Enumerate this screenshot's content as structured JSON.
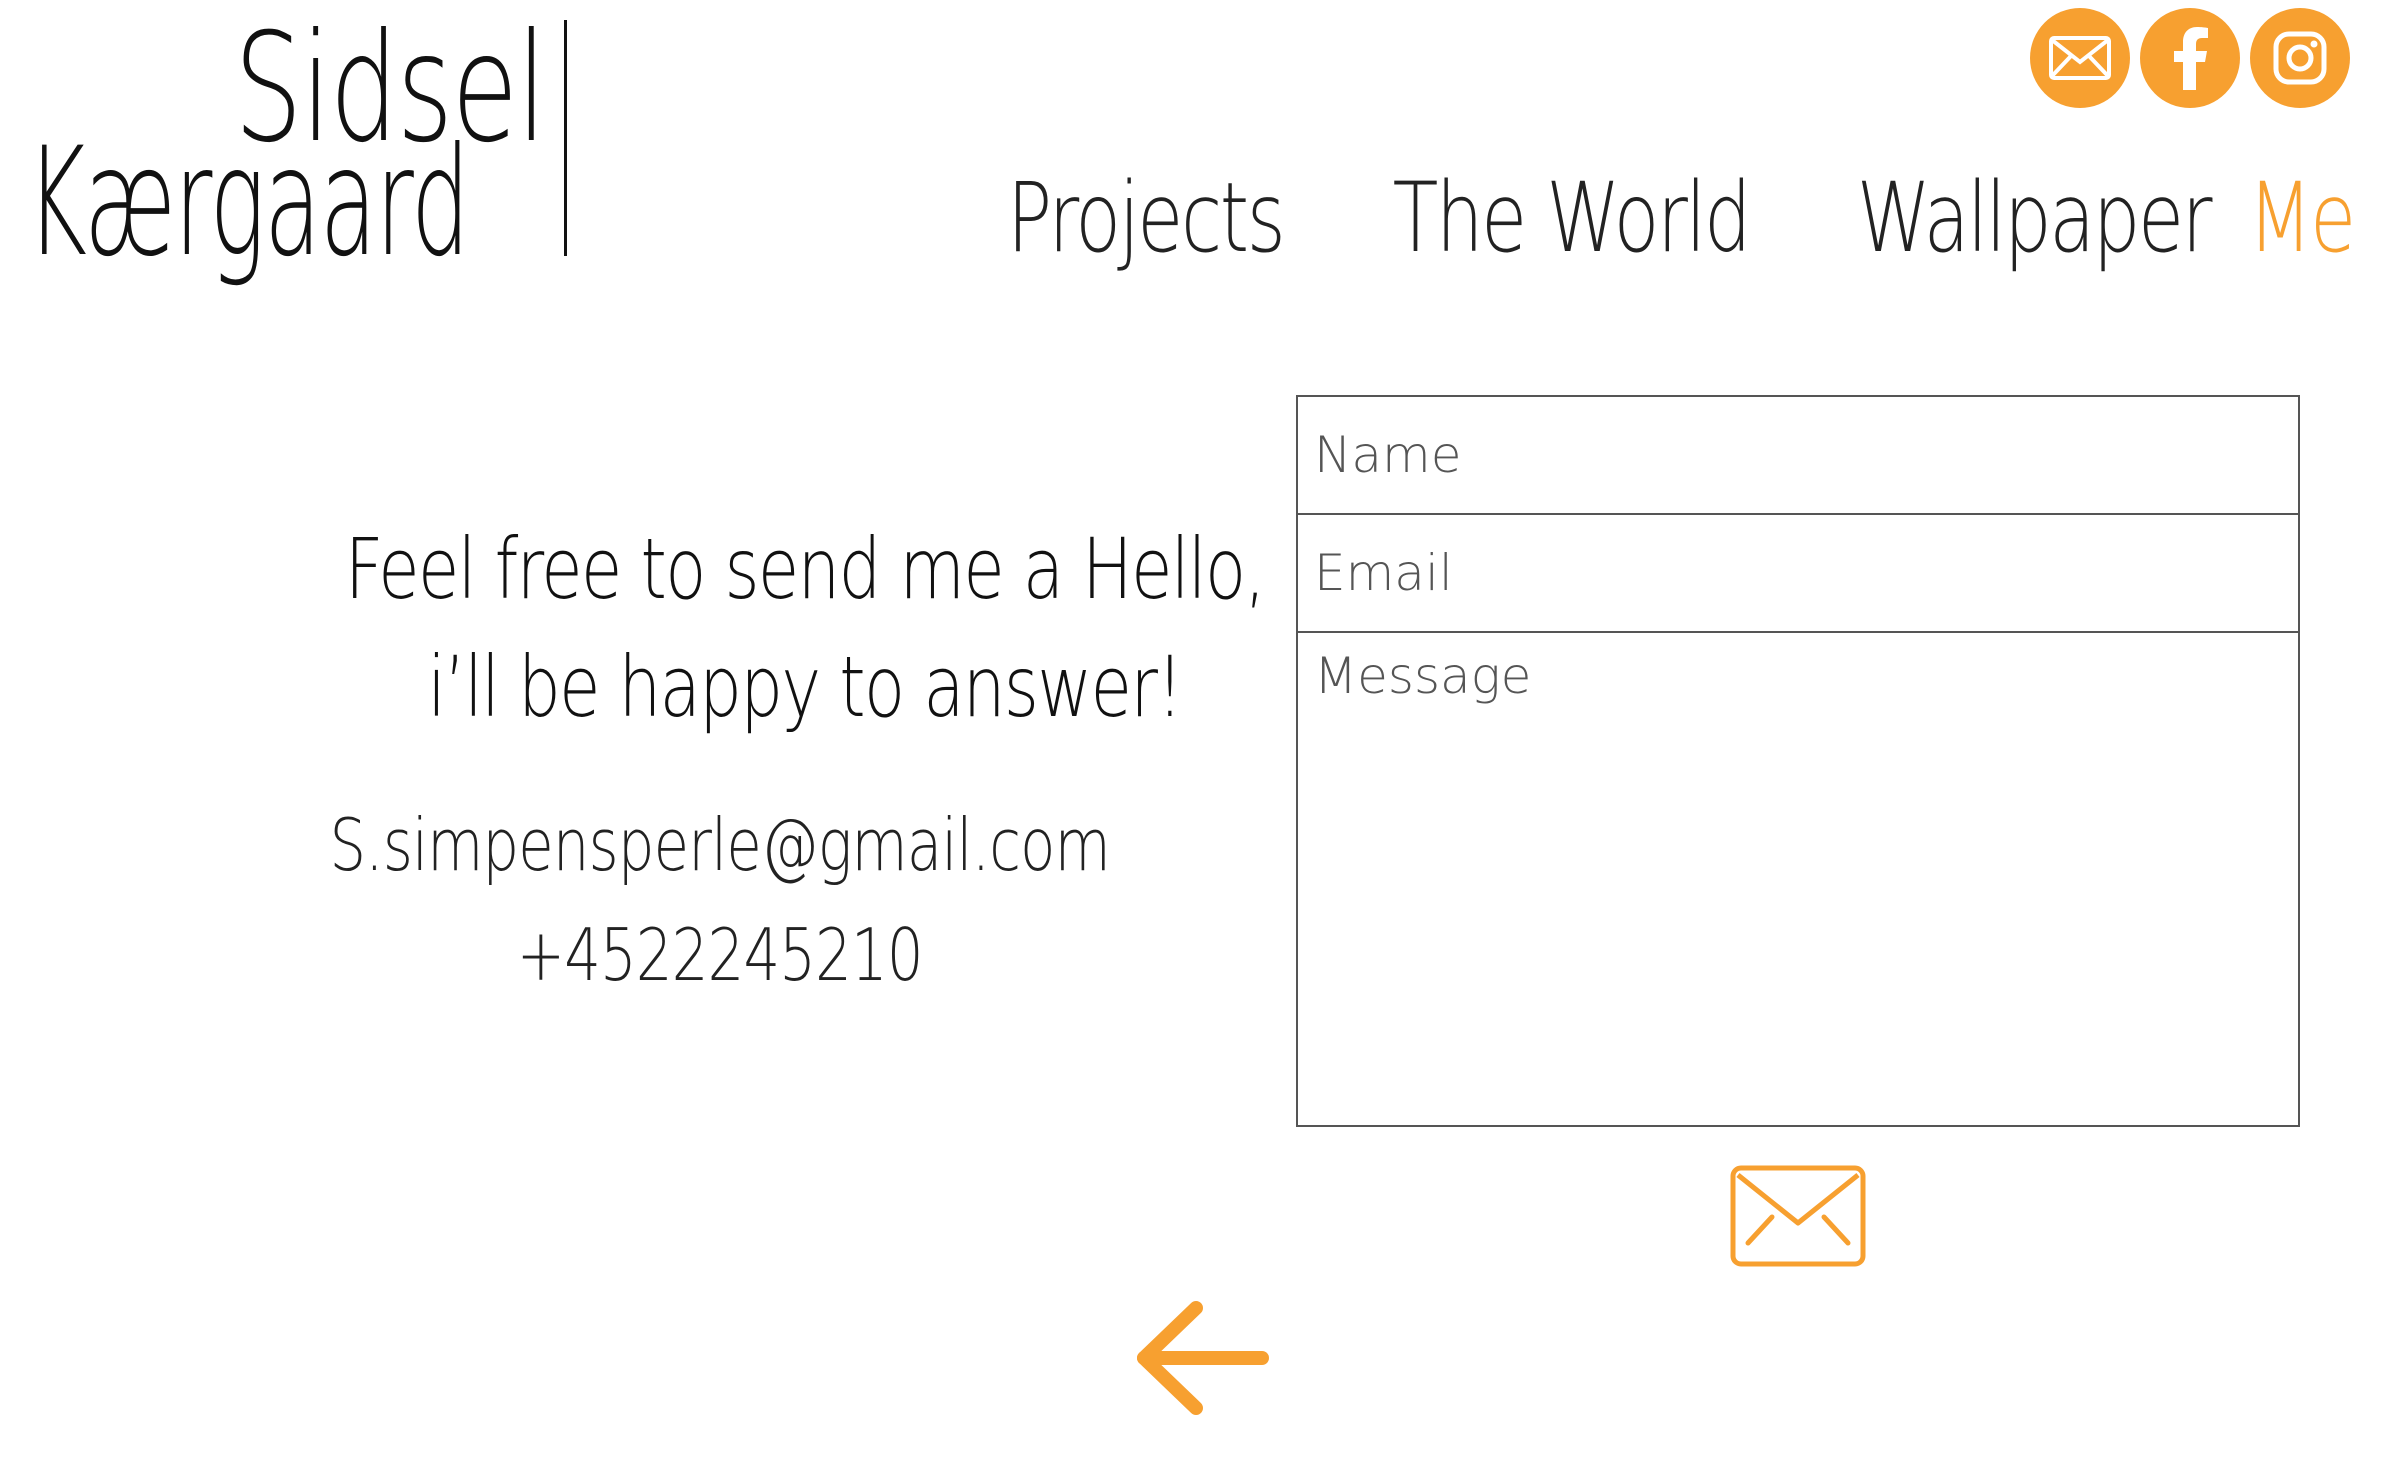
{
  "logo": {
    "line1": "Sidsel",
    "line2": "Kærgaard"
  },
  "social": [
    {
      "icon": "mail-icon",
      "label": "email"
    },
    {
      "icon": "facebook-icon",
      "label": "facebook"
    },
    {
      "icon": "instagram-icon",
      "label": "instagram"
    }
  ],
  "nav": {
    "items": [
      {
        "label": "Projects",
        "active": false
      },
      {
        "label": "The World",
        "active": false
      },
      {
        "label": "Wallpaper",
        "active": false
      },
      {
        "label": "Me",
        "active": true
      }
    ]
  },
  "info": {
    "tagline_line1": "Feel free to send me a Hello,",
    "tagline_line2": "i’ll be happy to answer!",
    "email": "S.simpensperle@gmail.com",
    "phone": "+4522245210"
  },
  "form": {
    "name_placeholder": "Name",
    "email_placeholder": "Email",
    "message_placeholder": "Message",
    "name_value": "",
    "email_value": "",
    "message_value": ""
  },
  "icons": {
    "send": "envelope-send-icon",
    "back": "arrow-left-icon"
  },
  "colors": {
    "accent": "#f7a030",
    "text": "#111111",
    "border": "#555555",
    "background": "#ffffff"
  }
}
